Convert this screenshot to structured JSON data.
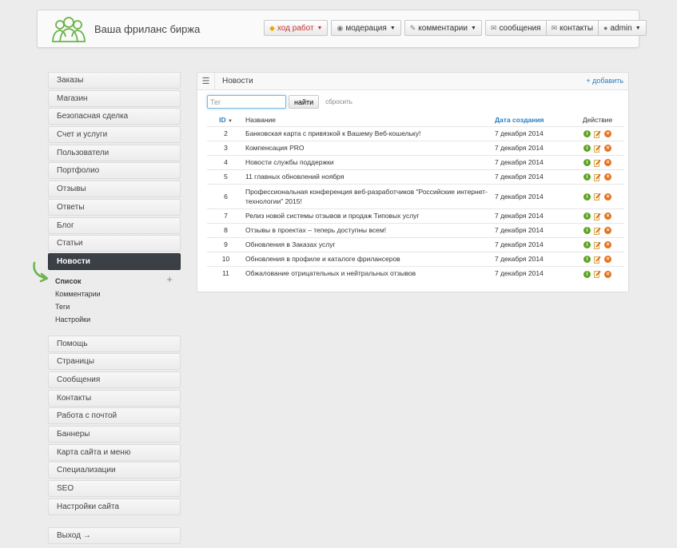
{
  "header": {
    "site_title": "Ваша фриланс биржа",
    "nav": [
      {
        "label": "ход работ",
        "icon": "shield-icon"
      },
      {
        "label": "модерация",
        "icon": "eye-icon"
      },
      {
        "label": "комментарии",
        "icon": "pencil-icon"
      },
      {
        "label": "сообщения",
        "icon": "envelope-icon"
      },
      {
        "label": "контакты",
        "icon": "envelope-icon"
      },
      {
        "label": "admin",
        "icon": "user-icon"
      }
    ]
  },
  "sidebar": {
    "items_top": [
      "Заказы",
      "Магазин",
      "Безопасная сделка",
      "Счет и услуги",
      "Пользователи",
      "Портфолио",
      "Отзывы",
      "Ответы",
      "Блог",
      "Статьи",
      "Новости"
    ],
    "submenu": [
      "Список",
      "Комментарии",
      "Теги",
      "Настройки"
    ],
    "items_bottom": [
      "Помощь",
      "Страницы",
      "Сообщения",
      "Контакты",
      "Работа с почтой",
      "Баннеры",
      "Карта сайта и меню",
      "Специализации",
      "SEO",
      "Настройки сайта"
    ],
    "logout": "Выход →",
    "plus": "+"
  },
  "panel": {
    "title": "Новости",
    "add_link": "+ добавить",
    "filter": {
      "placeholder": "Тег",
      "find_label": "найти",
      "reset_label": "сбросить"
    },
    "columns": {
      "id": "ID",
      "name": "Название",
      "date": "Дата создания",
      "action": "Действие"
    },
    "rows": [
      {
        "id": "2",
        "name": "Банковская карта с привязкой к Вашему Веб-кошельку!",
        "date": "7 декабря 2014"
      },
      {
        "id": "3",
        "name": "Компенсация PRO",
        "date": "7 декабря 2014"
      },
      {
        "id": "4",
        "name": "Новости службы поддержки",
        "date": "7 декабря 2014"
      },
      {
        "id": "5",
        "name": "11 главных обновлений ноября",
        "date": "7 декабря 2014"
      },
      {
        "id": "6",
        "name": "Профессиональная конференция веб-разработчиков \"Российские интернет-технологии\" 2015!",
        "date": "7 декабря 2014"
      },
      {
        "id": "7",
        "name": "Релиз новой системы отзывов и продаж Типовых услуг",
        "date": "7 декабря 2014"
      },
      {
        "id": "8",
        "name": "Отзывы в проектах – теперь доступны всем!",
        "date": "7 декабря 2014"
      },
      {
        "id": "9",
        "name": "Обновления в Заказах услуг",
        "date": "7 декабря 2014"
      },
      {
        "id": "10",
        "name": "Обновления в профиле и каталоге фрилансеров",
        "date": "7 декабря 2014"
      },
      {
        "id": "11",
        "name": "Обжалование отрицательных и нейтральных отзывов",
        "date": "7 декабря 2014"
      }
    ]
  }
}
